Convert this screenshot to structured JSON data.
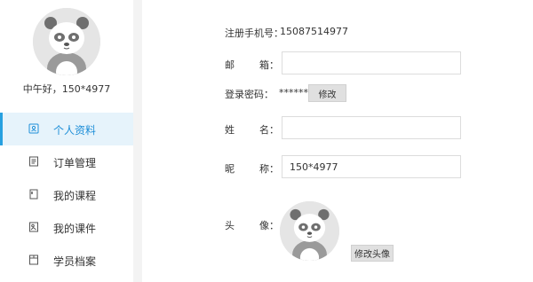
{
  "user": {
    "greeting": "中午好，150*4977"
  },
  "menu": {
    "items": [
      {
        "label": "个人资料",
        "icon": "profile-card-icon",
        "active": true
      },
      {
        "label": "订单管理",
        "icon": "order-list-icon",
        "active": false
      },
      {
        "label": "我的课程",
        "icon": "course-book-icon",
        "active": false
      },
      {
        "label": "我的课件",
        "icon": "courseware-icon",
        "active": false
      },
      {
        "label": "学员档案",
        "icon": "archive-icon",
        "active": false
      }
    ]
  },
  "profile": {
    "phone_label": "注册手机号：",
    "phone_value": "15087514977",
    "email_label": "邮        箱：",
    "email_value": "",
    "password_label": "登录密码：",
    "password_value": "******",
    "password_button": "修改",
    "name_label": "姓        名：",
    "name_value": "",
    "nickname_label": "昵        称：",
    "nickname_value": "150*4977",
    "avatar_label": "头        像：",
    "avatar_button": "修改头像"
  },
  "colors": {
    "accent": "#27a0e0",
    "active_bg": "#e6f3fb",
    "gutter": "#f3f3f3"
  }
}
